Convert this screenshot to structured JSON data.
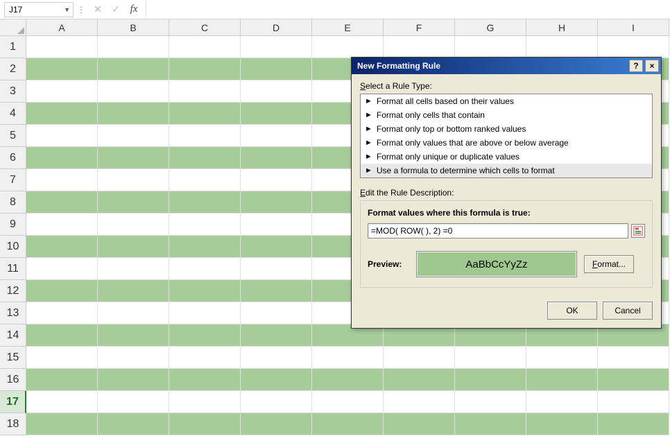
{
  "formula_bar": {
    "name_box": "J17",
    "fx_label": "fx",
    "formula_value": ""
  },
  "grid": {
    "columns": [
      "A",
      "B",
      "C",
      "D",
      "E",
      "F",
      "G",
      "H",
      "I"
    ],
    "rows": [
      "1",
      "2",
      "3",
      "4",
      "5",
      "6",
      "7",
      "8",
      "9",
      "10",
      "11",
      "12",
      "13",
      "14",
      "15",
      "16",
      "17",
      "18"
    ],
    "active_row": "17",
    "band_color": "#a7cc9a"
  },
  "dialog": {
    "title": "New Formatting Rule",
    "select_label": "Select a Rule Type:",
    "rules": [
      "Format all cells based on their values",
      "Format only cells that contain",
      "Format only top or bottom ranked values",
      "Format only values that are above or below average",
      "Format only unique or duplicate values",
      "Use a formula to determine which cells to format"
    ],
    "selected_rule_index": 5,
    "edit_label": "Edit the Rule Description:",
    "formula_caption": "Format values where this formula is true:",
    "formula_value": "=MOD( ROW( ), 2) =0",
    "preview_label": "Preview:",
    "preview_text": "AaBbCcYyZz",
    "format_button": "Format...",
    "ok_button": "OK",
    "cancel_button": "Cancel",
    "help_symbol": "?",
    "close_symbol": "×"
  }
}
